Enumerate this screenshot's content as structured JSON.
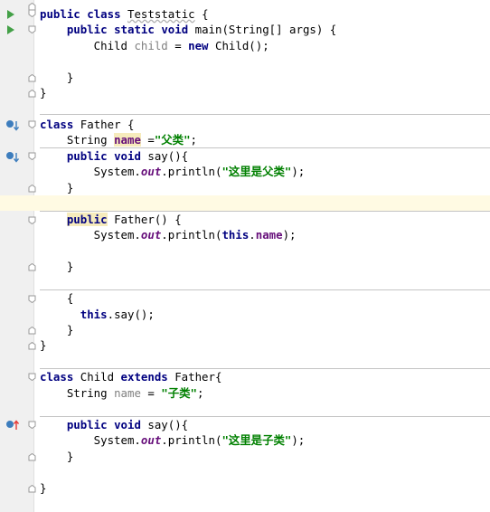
{
  "editor": {
    "colors": {
      "keyword": "#000080",
      "field": "#660e7a",
      "string": "#008000",
      "unused": "#808080",
      "run_icon": "#43a047",
      "override_icon": "#3d7dbd",
      "implements_arrow": "#e53935"
    },
    "gutter_icons": [
      "run-icon",
      "run-icon",
      "overridden-method-icon",
      "overridden-method-icon",
      "implements-method-icon"
    ]
  },
  "code": {
    "l1": {
      "kw1": "public",
      "kw2": "class",
      "name": "Teststatic",
      "rest": " {"
    },
    "l2": {
      "a": "    ",
      "kw1": "public",
      "kw2": "static",
      "kw3": "void",
      "rest": " main(String[] args) {"
    },
    "l3": {
      "a": "        Child ",
      "var": "child",
      "b": " = ",
      "kw": "new",
      "c": " Child();"
    },
    "l5": "    }",
    "l6": "}",
    "l7": {
      "kw": "class",
      "rest": " Father {"
    },
    "l8": {
      "a": "    String ",
      "fld": "name",
      "b": " =",
      "str": "\"父类\"",
      "c": ";"
    },
    "l9": {
      "a": "    ",
      "kw1": "public",
      "kw2": "void",
      "rest": " say(){"
    },
    "l10": {
      "a": "        System.",
      "out": "out",
      "b": ".println(",
      "str": "\"这里是父类\"",
      "c": ");"
    },
    "l11": "    }",
    "l13": {
      "a": "    ",
      "kw": "public",
      "rest": " Father() {"
    },
    "l14": {
      "a": "        System.",
      "out": "out",
      "b": ".println(",
      "kw": "this",
      "c": ".",
      "fld": "name",
      "d": ");"
    },
    "l16": "    }",
    "l18": "    {",
    "l19": {
      "a": "      ",
      "kw": "this",
      "rest": ".say();"
    },
    "l20": "    }",
    "l21": "}",
    "l23": {
      "kw1": "class",
      "a": " Child ",
      "kw2": "extends",
      "rest": " Father{"
    },
    "l24": {
      "a": "    String ",
      "var": "name",
      "b": " = ",
      "str": "\"子类\"",
      "c": ";"
    },
    "l26": {
      "a": "    ",
      "kw1": "public",
      "kw2": "void",
      "rest": " say(){"
    },
    "l27": {
      "a": "        System.",
      "out": "out",
      "b": ".println(",
      "str": "\"这里是子类\"",
      "c": ");"
    },
    "l28": "    }",
    "l30": "}"
  }
}
